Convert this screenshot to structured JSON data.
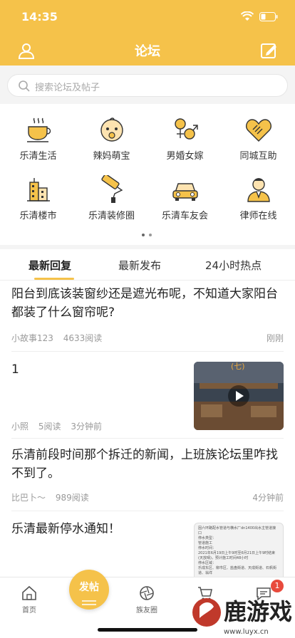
{
  "status_bar": {
    "time": "14:35"
  },
  "nav": {
    "title": "论坛"
  },
  "search": {
    "placeholder": "搜索论坛及帖子"
  },
  "categories": [
    {
      "label": "乐清生活",
      "icon": "coffee-cup-icon"
    },
    {
      "label": "辣妈萌宝",
      "icon": "baby-face-icon"
    },
    {
      "label": "男婚女嫁",
      "icon": "gender-symbols-icon"
    },
    {
      "label": "同城互助",
      "icon": "handshake-heart-icon"
    },
    {
      "label": "乐清楼市",
      "icon": "buildings-icon"
    },
    {
      "label": "乐清装修圈",
      "icon": "paint-roller-icon"
    },
    {
      "label": "乐清车友会",
      "icon": "car-icon"
    },
    {
      "label": "律师在线",
      "icon": "lawyer-icon"
    }
  ],
  "tabs": [
    {
      "label": "最新回复",
      "active": true
    },
    {
      "label": "最新发布",
      "active": false
    },
    {
      "label": "24小时热点",
      "active": false
    }
  ],
  "posts": [
    {
      "title": "阳台到底该装窗纱还是遮光布呢，不知道大家阳台都装了什么窗帘呢?",
      "author": "小故事123",
      "reads": "4633阅读",
      "time": "刚刚"
    },
    {
      "title": "1",
      "author": "小照",
      "reads": "5阅读",
      "time": "3分钟前",
      "thumb_caption": "(七)"
    },
    {
      "title": "乐清前段时间那个拆迁的新闻，上班族论坛里咋找不到了。",
      "author": "比巴卜～",
      "reads": "989阅读",
      "time": "4分钟前"
    },
    {
      "title": "乐清最新停水通知！",
      "notice_lines": [
        "因六环路配水管道与横水厂dn1400出水主管道接口",
        "停水类型：",
        "管道施工",
        "停水时间：",
        "2021年6月19日上午9时至6月21日上午9时结束(天放晴)，预计施工时间48小时",
        "停水区域：",
        "乐成东区、柳市区、盐盘街道、天成街道、石帆街道、翁垟"
      ]
    }
  ],
  "tabbar": {
    "home": "首页",
    "post": "发帖",
    "friends": "族友圈",
    "badge": "1"
  },
  "watermark": {
    "brand": "鹿游戏",
    "url": "www.luyx.cn"
  },
  "colors": {
    "accent": "#f5c24a",
    "badge": "#e84a3c"
  }
}
